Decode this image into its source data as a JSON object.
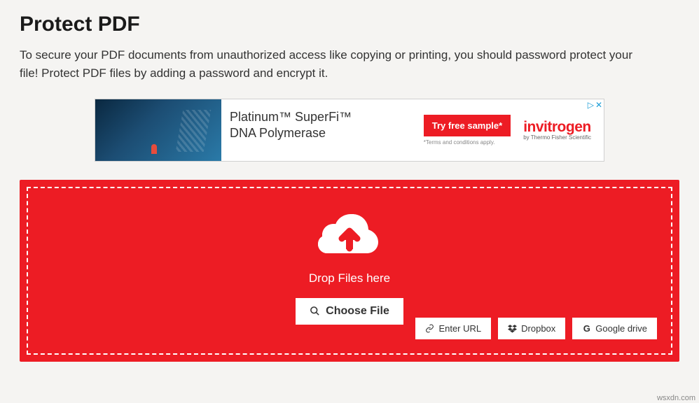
{
  "page": {
    "title": "Protect PDF",
    "description": "To secure your PDF documents from unauthorized access like copying or printing, you should password protect your file! Protect PDF files by adding a password and encrypt it."
  },
  "ad": {
    "headline_line1": "Platinum™ SuperFi™",
    "headline_line2": "DNA Polymerase",
    "cta": "Try free sample*",
    "terms": "*Terms and conditions apply.",
    "brand_name": "invitrogen",
    "brand_sub": "by Thermo Fisher Scientific",
    "adchoices_label": "▷",
    "close_label": "✕"
  },
  "upload": {
    "drop_text": "Drop Files here",
    "choose_file": "Choose File",
    "enter_url": "Enter URL",
    "dropbox": "Dropbox",
    "google_drive": "Google drive"
  },
  "watermark": "wsxdn.com"
}
